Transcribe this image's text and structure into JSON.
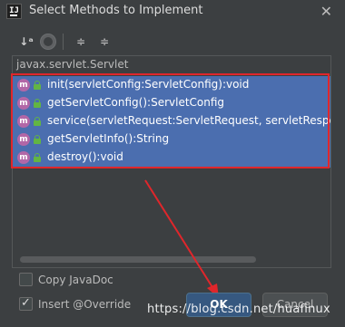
{
  "window": {
    "app_icon_text": "IJ",
    "title": "Select Methods to Implement",
    "close_glyph": "✕"
  },
  "toolbar": {
    "sort_glyph": "↓ᵃ",
    "expand_glyph": "≑",
    "collapse_glyph": "≑"
  },
  "tree": {
    "group_label": "javax.servlet.Servlet",
    "methods": [
      {
        "icon_letter": "m",
        "signature": "init(servletConfig:ServletConfig):void"
      },
      {
        "icon_letter": "m",
        "signature": "getServletConfig():ServletConfig"
      },
      {
        "icon_letter": "m",
        "signature": "service(servletRequest:ServletRequest, servletRespons"
      },
      {
        "icon_letter": "m",
        "signature": "getServletInfo():String"
      },
      {
        "icon_letter": "m",
        "signature": "destroy():void"
      }
    ]
  },
  "options": {
    "copy_javadoc": {
      "label": "Copy JavaDoc",
      "checked": false
    },
    "insert_override": {
      "label": "Insert @Override",
      "checked": true
    }
  },
  "buttons": {
    "ok": "OK",
    "cancel": "Cancel"
  },
  "watermark": "https://blog.csdn.net/huafinux",
  "colors": {
    "selection": "#4b6eaf",
    "annotation_red": "#e0262b",
    "method_icon": "#b267a7",
    "lock_icon": "#62b543"
  }
}
